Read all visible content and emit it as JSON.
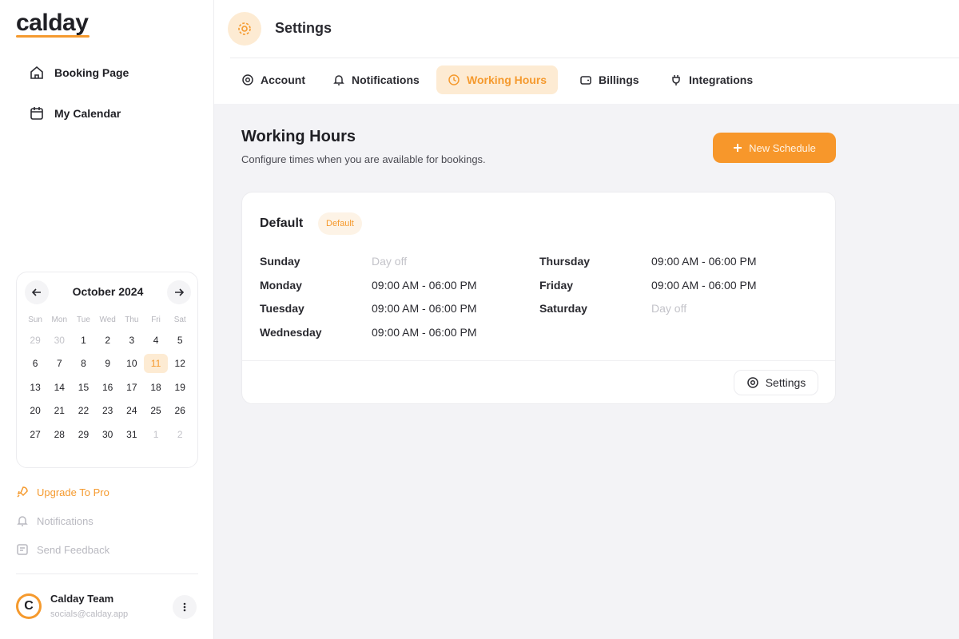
{
  "brand": {
    "logo": "calday",
    "accent": "#f59a2e"
  },
  "sidebar": {
    "nav": [
      {
        "label": "Booking Page",
        "icon": "home-icon"
      },
      {
        "label": "My Calendar",
        "icon": "calendar-icon"
      }
    ],
    "calendar": {
      "month": "October 2024",
      "weekdays": [
        "Sun",
        "Mon",
        "Tue",
        "Wed",
        "Thu",
        "Fri",
        "Sat"
      ],
      "weeks": [
        [
          "29",
          "30",
          "1",
          "2",
          "3",
          "4",
          "5"
        ],
        [
          "6",
          "7",
          "8",
          "9",
          "10",
          "11",
          "12"
        ],
        [
          "13",
          "14",
          "15",
          "16",
          "17",
          "18",
          "19"
        ],
        [
          "20",
          "21",
          "22",
          "23",
          "24",
          "25",
          "26"
        ],
        [
          "27",
          "28",
          "29",
          "30",
          "31",
          "1",
          "2"
        ]
      ],
      "selected": "11"
    },
    "links": {
      "upgrade": "Upgrade To Pro",
      "notifications": "Notifications",
      "feedback": "Send Feedback"
    },
    "user": {
      "initial": "C",
      "name": "Calday Team",
      "email": "socials@calday.app"
    }
  },
  "header": {
    "title": "Settings",
    "tabs": [
      {
        "label": "Account",
        "icon": "gear-icon"
      },
      {
        "label": "Notifications",
        "icon": "bell-icon"
      },
      {
        "label": "Working Hours",
        "icon": "clock-icon",
        "active": true
      },
      {
        "label": "Billings",
        "icon": "wallet-icon"
      },
      {
        "label": "Integrations",
        "icon": "plug-icon"
      }
    ]
  },
  "main": {
    "title": "Working Hours",
    "subtitle": "Configure times when you are available for bookings.",
    "new_button": "New Schedule",
    "schedule": {
      "name": "Default",
      "badge": "Default",
      "left": [
        {
          "day": "Sunday",
          "time": "Day off",
          "off": true
        },
        {
          "day": "Monday",
          "time": "09:00 AM - 06:00 PM"
        },
        {
          "day": "Tuesday",
          "time": "09:00 AM - 06:00 PM"
        },
        {
          "day": "Wednesday",
          "time": "09:00 AM - 06:00 PM"
        }
      ],
      "right": [
        {
          "day": "Thursday",
          "time": "09:00 AM - 06:00 PM"
        },
        {
          "day": "Friday",
          "time": "09:00 AM - 06:00 PM"
        },
        {
          "day": "Saturday",
          "time": "Day off",
          "off": true
        }
      ],
      "settings_button": "Settings"
    }
  }
}
